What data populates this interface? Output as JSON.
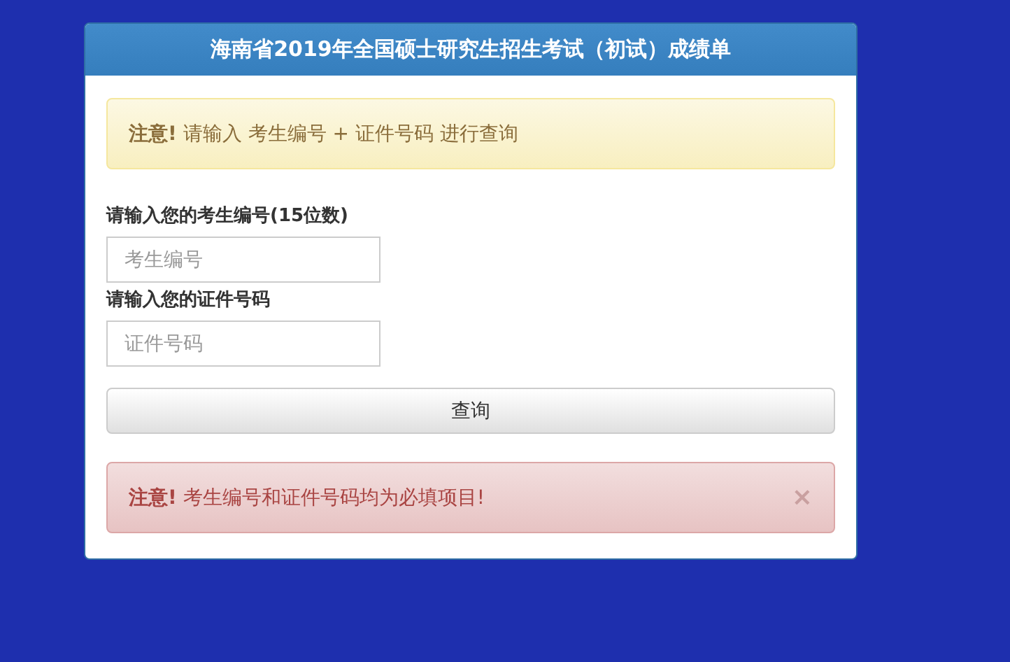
{
  "panel": {
    "title": "海南省2019年全国硕士研究生招生考试（初试）成绩单"
  },
  "notice": {
    "kind": "warning",
    "text": "**注意!** 请输入 考生编号 + 证件号码 进行查询"
  },
  "fields": [
    {
      "label": "请输入您的考生编号(15位数)",
      "placeholder": "考生编号"
    },
    {
      "label": "请输入您的证件号码",
      "placeholder": "证件号码"
    }
  ],
  "submit_button": "查询",
  "error": {
    "kind": "danger",
    "text": "**注意!** 考生编号和证件号码均为必填项目!",
    "close": "×"
  }
}
